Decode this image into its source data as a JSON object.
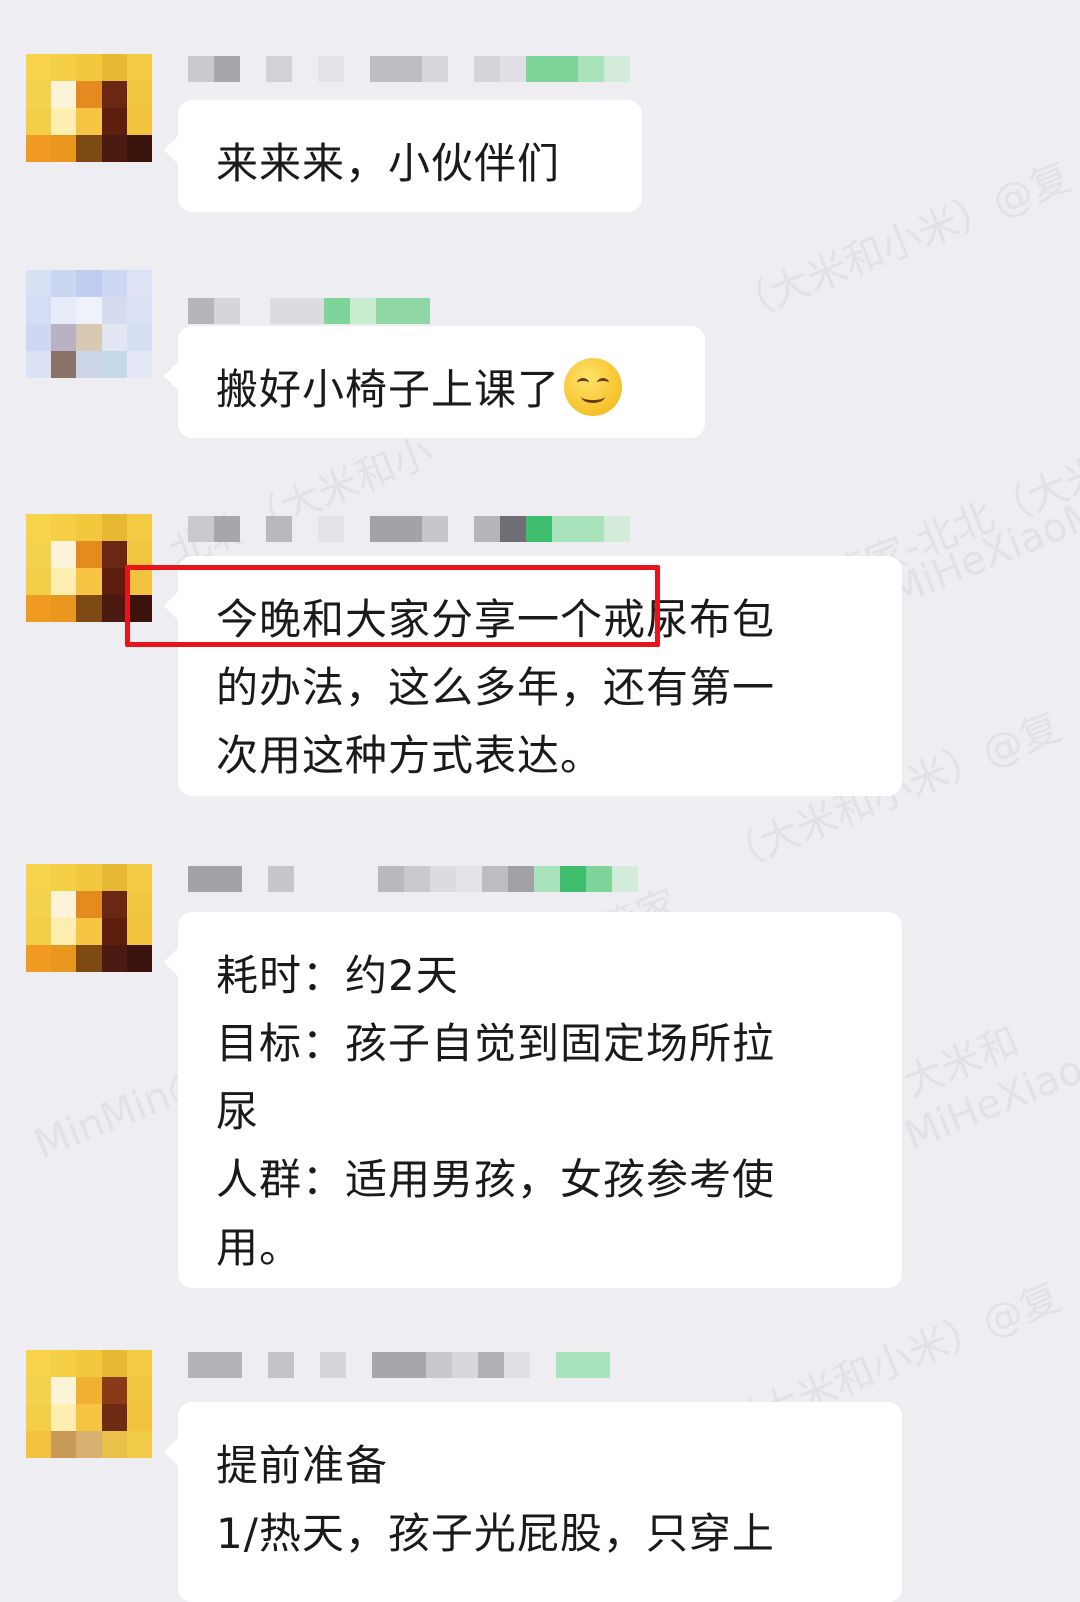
{
  "messages": [
    {
      "lines": [
        "来来来，小伙伴们"
      ]
    },
    {
      "lines": [
        "搬好小椅子上课了"
      ],
      "emoji": "smiling-face-icon"
    },
    {
      "lines": [
        "今晚和大家分享一个戒尿布包",
        "的办法，这么多年，还有第一",
        "次用这种方式表达。"
      ]
    },
    {
      "lines": [
        "耗时：约2天",
        "目标：孩子自觉到固定场所拉",
        "尿",
        "人群：适用男孩，女孩参考使",
        "用。"
      ]
    },
    {
      "lines": [
        "提前准备",
        "1/热天，孩子光屁股，只穿上"
      ]
    }
  ],
  "watermarks": [
    "（大米和小米）@复",
    "（大米和小米）@复",
    "北北（大米和小",
    "社群管家-北北（大米和",
    "DaMiHeXiaoM",
    "社群管家",
    "MinMin@",
    "（大米和小米）@复",
    "大米和",
    "MiHeXiao"
  ],
  "colors": {
    "highlight": "#e8141c",
    "background": "#eeeef2",
    "bubble": "#ffffff"
  }
}
